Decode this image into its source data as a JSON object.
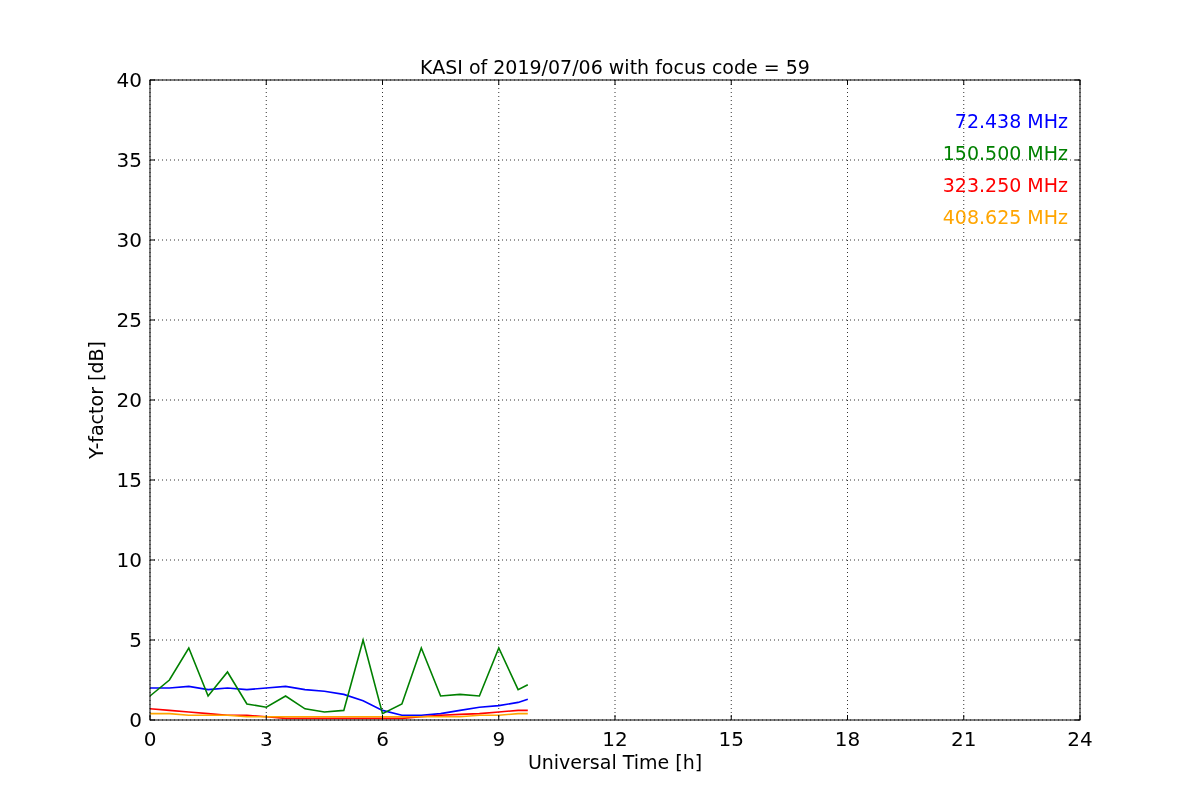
{
  "chart_data": {
    "type": "line",
    "title": "KASI of 2019/07/06 with focus code = 59",
    "xlabel": "Universal Time [h]",
    "ylabel": "Y-factor [dB]",
    "x": [
      0,
      0.5,
      1,
      1.5,
      2,
      2.5,
      3,
      3.5,
      4,
      4.5,
      5,
      5.5,
      6,
      6.5,
      7,
      7.5,
      8,
      8.5,
      9,
      9.5,
      9.75
    ],
    "series": [
      {
        "name": "72.438 MHz",
        "color": "#0000ff",
        "values": [
          2.0,
          2.0,
          2.1,
          1.9,
          2.0,
          1.9,
          2.0,
          2.1,
          1.9,
          1.8,
          1.6,
          1.2,
          0.6,
          0.3,
          0.3,
          0.4,
          0.6,
          0.8,
          0.9,
          1.1,
          1.3
        ]
      },
      {
        "name": "150.500 MHz",
        "color": "#008000",
        "values": [
          1.5,
          2.5,
          4.5,
          1.5,
          3.0,
          1.0,
          0.8,
          1.5,
          0.7,
          0.5,
          0.6,
          5.0,
          0.4,
          1.0,
          4.5,
          1.5,
          1.6,
          1.5,
          4.5,
          1.9,
          2.2
        ]
      },
      {
        "name": "323.250 MHz",
        "color": "#ff0000",
        "values": [
          0.7,
          0.6,
          0.5,
          0.4,
          0.3,
          0.3,
          0.2,
          0.1,
          0.1,
          0.1,
          0.1,
          0.1,
          0.1,
          0.1,
          0.2,
          0.3,
          0.35,
          0.4,
          0.5,
          0.6,
          0.6
        ]
      },
      {
        "name": "408.625 MHz",
        "color": "#ffa500",
        "values": [
          0.4,
          0.4,
          0.3,
          0.3,
          0.3,
          0.2,
          0.2,
          0.2,
          0.2,
          0.2,
          0.2,
          0.2,
          0.2,
          0.2,
          0.2,
          0.2,
          0.2,
          0.3,
          0.3,
          0.4,
          0.4
        ]
      }
    ],
    "xlim": [
      0,
      24
    ],
    "ylim": [
      0,
      40
    ],
    "xticks": [
      0,
      3,
      6,
      9,
      12,
      15,
      18,
      21,
      24
    ],
    "yticks": [
      0,
      5,
      10,
      15,
      20,
      25,
      30,
      35,
      40
    ],
    "grid": true
  }
}
